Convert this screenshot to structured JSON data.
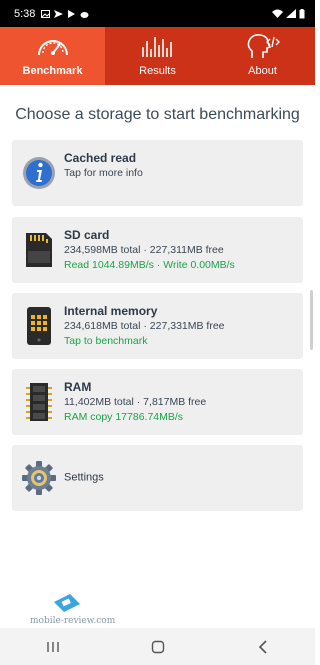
{
  "status_bar": {
    "time": "5:38",
    "icons": [
      "gallery-icon",
      "send-icon",
      "play-icon",
      "cloud-icon"
    ],
    "right_icons": [
      "wifi-icon",
      "signal-icon",
      "battery-icon"
    ]
  },
  "tabs": [
    {
      "label": "Benchmark",
      "icon": "speedometer-icon",
      "active": true
    },
    {
      "label": "Results",
      "icon": "bars-icon",
      "active": false
    },
    {
      "label": "About",
      "icon": "head-code-icon",
      "active": false
    }
  ],
  "heading": "Choose a storage to start benchmarking",
  "cards": {
    "cached": {
      "title": "Cached read",
      "subtitle": "Tap for more info",
      "icon": "info-icon"
    },
    "sdcard": {
      "title": "SD card",
      "sizes": "234,598MB total · 227,311MB free",
      "speed": "Read 1044.89MB/s · Write 0.00MB/s",
      "icon": "sd-card-icon"
    },
    "internal": {
      "title": "Internal memory",
      "sizes": "234,618MB total · 227,331MB free",
      "status": "Tap to benchmark",
      "icon": "phone-chip-icon"
    },
    "ram": {
      "title": "RAM",
      "sizes": "11,402MB total · 7,817MB free",
      "speed": "RAM copy 17786.74MB/s",
      "icon": "ram-stick-icon"
    },
    "settings": {
      "title": "Settings",
      "icon": "gear-icon"
    }
  },
  "watermark": {
    "text": "mobile-review.com"
  },
  "colors": {
    "tab_bar": "#e14423",
    "tab_active": "#ee5430",
    "green": "#1aa34a"
  }
}
